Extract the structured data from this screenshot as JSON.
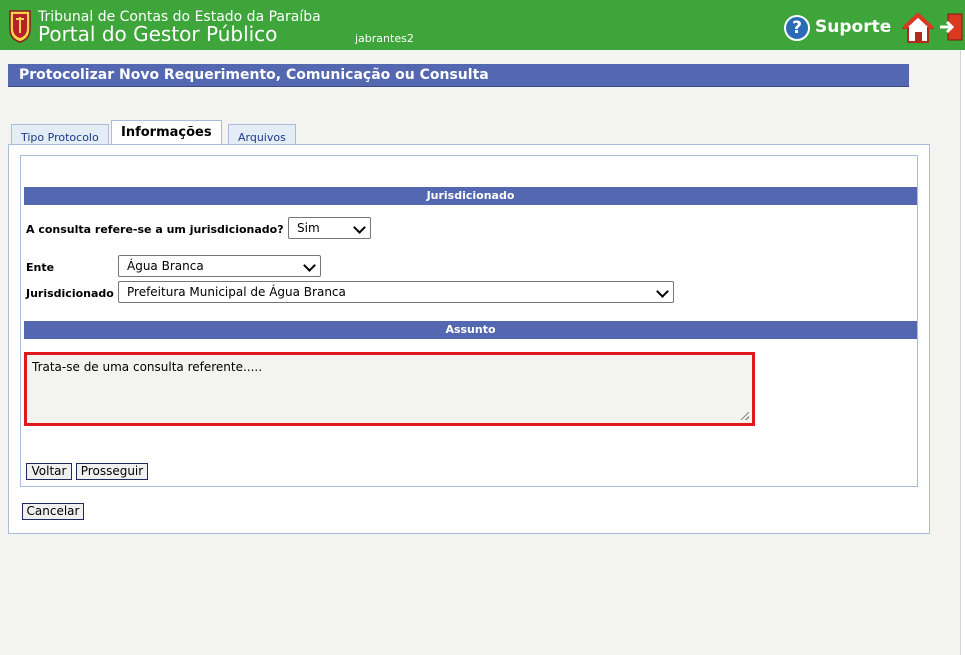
{
  "header": {
    "org_name": "Tribunal de Contas do Estado da Paraíba",
    "portal_name": "Portal do Gestor Público",
    "username": "jabrantes2",
    "support_label": "Suporte",
    "help_icon_glyph": "?",
    "icons": [
      "crest-icon",
      "help-icon",
      "home-icon",
      "logout-icon"
    ],
    "brand_color": "#3ea53a"
  },
  "page": {
    "title": "Protocolizar Novo Requerimento, Comunicação ou Consulta",
    "accent_color": "#5468b1"
  },
  "tabs": [
    {
      "label": "Tipo Protocolo",
      "active": false
    },
    {
      "label": "Informações",
      "active": true
    },
    {
      "label": "Arquivos",
      "active": false
    }
  ],
  "jurisdicionado_section": {
    "heading": "Jurisdicionado",
    "question_label": "A consulta refere-se a um jurisdicionado?",
    "question_value": "Sim",
    "ente_label": "Ente",
    "ente_value": "Água Branca",
    "jurisdicionado_label": "Jurisdicionado",
    "jurisdicionado_value": "Prefeitura Municipal de Água Branca"
  },
  "assunto_section": {
    "heading": "Assunto",
    "text": "Trata-se de uma consulta referente.....",
    "highlight_color": "#e0191e"
  },
  "buttons": {
    "voltar": "Voltar",
    "prosseguir": "Prosseguir",
    "cancelar": "Cancelar"
  }
}
